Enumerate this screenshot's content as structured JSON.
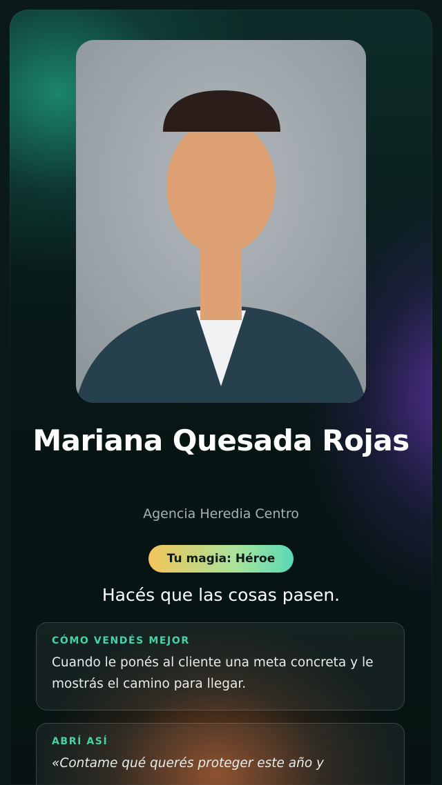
{
  "profile": {
    "name": "Mariana Quesada Rojas",
    "agency": "Agencia Heredia Centro",
    "badge": "Tu magia: Héroe",
    "tagline": "Hacés que las cosas pasen."
  },
  "sections": [
    {
      "title": "CÓMO VENDÉS MEJOR",
      "text": "Cuando le ponés al cliente una meta concreta y le mostrás el camino para llegar."
    },
    {
      "title": "ABRÍ ASÍ",
      "text": "«Contame qué querés proteger este año y"
    }
  ],
  "colors": {
    "accent": "#45d3a8",
    "badge_gradient_start": "#f3c45a",
    "badge_gradient_end": "#59d9b4"
  }
}
